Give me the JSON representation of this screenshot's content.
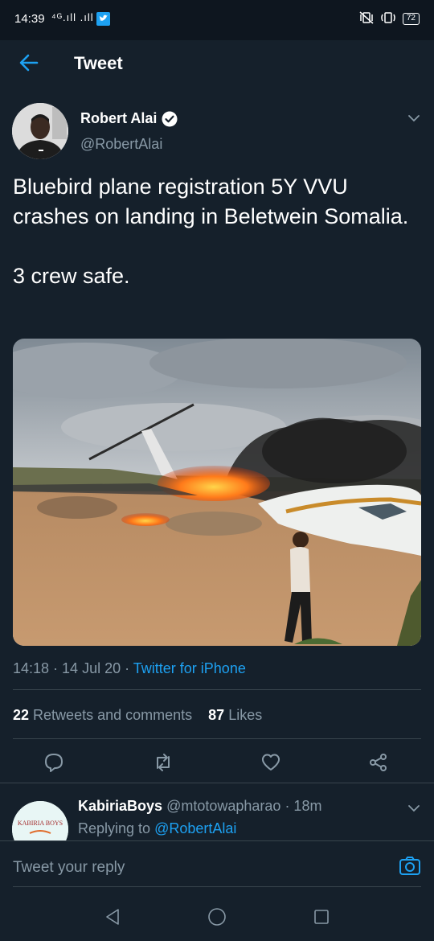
{
  "status_bar": {
    "time": "14:39",
    "signal": "⁴ᴳ.ıll .ıll",
    "battery": "72"
  },
  "header": {
    "title": "Tweet"
  },
  "author": {
    "name": "Robert Alai",
    "handle": "@RobertAlai"
  },
  "tweet": {
    "text": "Bluebird plane registration 5Y VVU crashes on landing in Beletwein Somalia.\n\n3 crew safe."
  },
  "meta": {
    "time": "14:18",
    "date": "14 Jul 20",
    "sep": " · ",
    "source": "Twitter for iPhone"
  },
  "stats": {
    "retweets_count": "22",
    "retweets_label": "Retweets and comments",
    "likes_count": "87",
    "likes_label": "Likes"
  },
  "reply": {
    "name": "KabiriaBoys",
    "handle": "@mtotowapharao",
    "time": "· 18m",
    "replying_label": "Replying to",
    "replying_to": "@RobertAlai",
    "avatar_text": "KABIRIA BOYS"
  },
  "composer": {
    "placeholder": "Tweet your reply"
  },
  "colors": {
    "background": "#15202b",
    "accent": "#1da1f2",
    "muted": "#8899a6",
    "divider": "#38444d"
  }
}
